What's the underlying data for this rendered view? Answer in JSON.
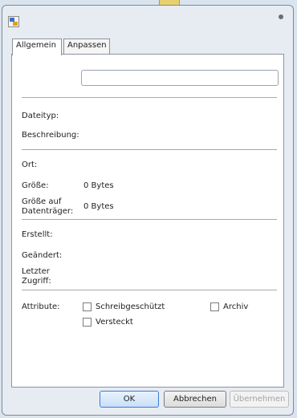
{
  "tabs": [
    {
      "label": "Allgemein",
      "active": true
    },
    {
      "label": "Anpassen",
      "active": false
    }
  ],
  "general": {
    "name_value": "",
    "filetype_label": "Dateityp:",
    "description_label": "Beschreibung:",
    "location_label": "Ort:",
    "size_label": "Größe:",
    "size_value": "0 Bytes",
    "size_on_disk_label_line1": "Größe auf",
    "size_on_disk_label_line2": "Datenträger:",
    "size_on_disk_value": "0 Bytes",
    "created_label": "Erstellt:",
    "modified_label": "Geändert:",
    "accessed_label_line1": "Letzter",
    "accessed_label_line2": "Zugriff:",
    "attributes_label": "Attribute:",
    "attributes": {
      "readonly": {
        "label": "Schreibgeschützt",
        "checked": false
      },
      "hidden": {
        "label": "Versteckt",
        "checked": false
      },
      "archive": {
        "label": "Archiv",
        "checked": false
      }
    }
  },
  "buttons": {
    "ok": "OK",
    "cancel": "Abbrechen",
    "apply": "Übernehmen"
  }
}
